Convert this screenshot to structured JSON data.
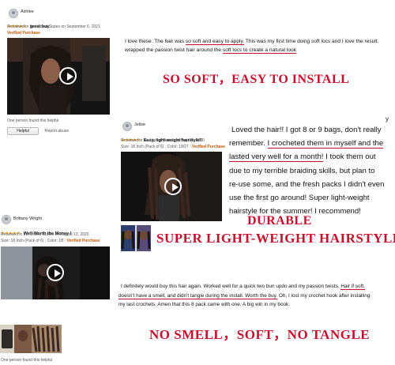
{
  "review1": {
    "reviewer": "Ashlee",
    "stars": "★★★★★",
    "title": "great buy",
    "meta": "Reviewed in the United States on September 6, 2021",
    "verified": "Verified Purchase",
    "helpful_count": "One person found this helpful",
    "helpful_button": "Helpful",
    "report": "Report abuse",
    "text_part1": "I love these. The hair was ",
    "text_underlined1": "so soft and easy to apply.",
    "text_part2": " This was my first time doing soft locs and I love the result.",
    "text_part3": "wrapped the passion twist hair around the ",
    "text_underlined2": "soft locs to create a natural look",
    "slogan": "SO SOFT，EASY TO INSTALL"
  },
  "review2": {
    "reviewer": "Jelise",
    "stars": "★★★★★",
    "title": "Easy, light-weight hairstyle!!",
    "meta": "Reviewed in the United States on May 25, 2020",
    "variant": "Size: 18 Inch (Pack of 6)",
    "color": "Color: 18/27",
    "verified": "Verified Purchase",
    "text_line1": "Loved the hair!! I got 8 or 9 bags, don't really",
    "text_line2a": "remember. ",
    "text_line2b": "I crocheted them in myself and the",
    "text_line3a": "lasted very well for a month!",
    "text_line3b": " I took them out",
    "text_line4": "due to my terrible braiding skills, but plan to",
    "text_line5": "re-use some, and the fresh packs I didn't even",
    "text_line6": "use the first go around! Super light-weight",
    "text_line7": "hairstyle for the summer! I recommend!",
    "stray": "y",
    "slogan1": "DURABLE",
    "slogan2": "SUPER LIGHT-WEIGHT HAIRSTYLE"
  },
  "review3": {
    "reviewer": "Brittany Wright",
    "stars": "★★★★★",
    "title": "Well Worth the Money !",
    "meta": "Reviewed in the United States on August 13, 2020",
    "variant": "Size: 18 Inch (Pack of 6)",
    "color": "Color: 1B",
    "verified": "Verified Purchase",
    "helpful_count": "One person found this helpful",
    "text_part1": "I definitely would buy this hair again. Worked well for a quick two bun updo and my passion twists. ",
    "text_underlined1": "Hair if soft,",
    "text_underlined2": "doesn't have a smell, and didn't tangle during the install. Worth the buy.",
    "text_part2": " Oh, I lost my crochet hook after installing",
    "text_part3": "my last crochets. Amen that this 8 pack came with one. A big win in my book.",
    "slogan": "NO SMELL，SOFT，NO TANGLE"
  },
  "colors": {
    "accent_red": "#c8102e",
    "star": "#f0a11c",
    "verified": "#c45500"
  }
}
